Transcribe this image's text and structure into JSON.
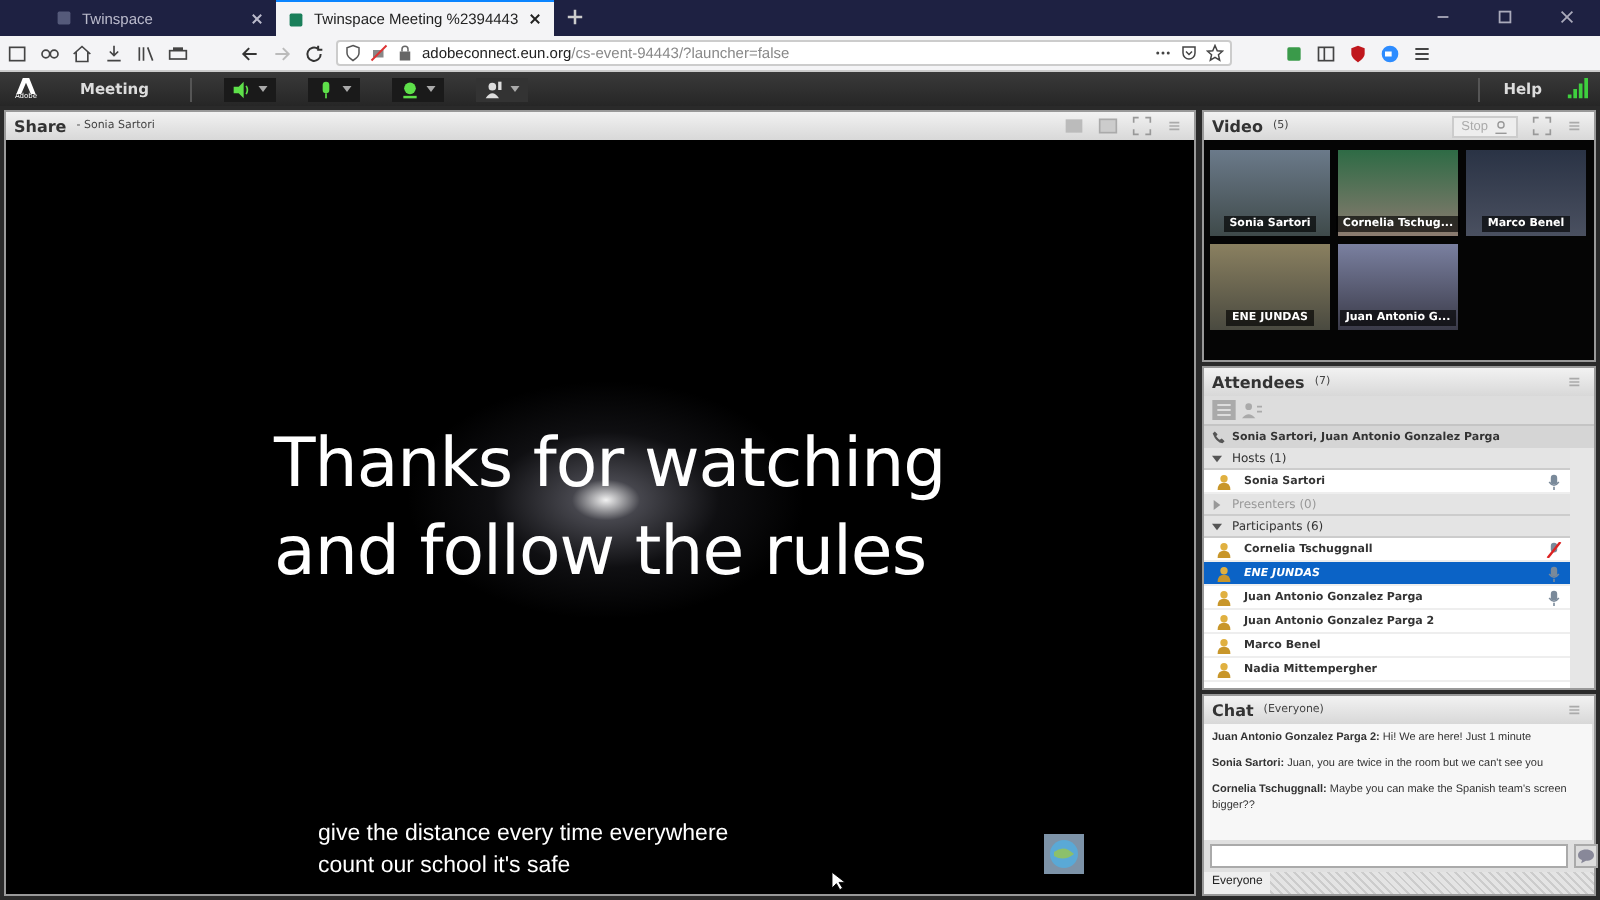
{
  "browser": {
    "tabs": [
      {
        "title": "Twinspace",
        "selected": false
      },
      {
        "title": "Twinspace Meeting %2394443",
        "selected": true
      }
    ],
    "url_host": "adobeconnect.eun.org",
    "url_path": "/cs-event-94443/?launcher=false"
  },
  "app_bar": {
    "logo": "Adobe",
    "menu": "Meeting",
    "controls": [
      {
        "kind": "speaker",
        "on": true
      },
      {
        "kind": "mic",
        "on": true
      },
      {
        "kind": "camera",
        "on": true
      },
      {
        "kind": "hand",
        "on": false
      }
    ],
    "help": "Help"
  },
  "share": {
    "title": "Share",
    "presenter": "- Sonia Sartori",
    "slide_lines": [
      "Thanks for watching",
      "and follow the rules"
    ],
    "captions": [
      "give the distance every time everywhere",
      "count our school it's safe"
    ]
  },
  "video": {
    "title": "Video",
    "count": "(5)",
    "stop": "Stop",
    "tiles": [
      {
        "name": "Sonia Sartori"
      },
      {
        "name": "Cornelia Tschug..."
      },
      {
        "name": "Marco Benel"
      },
      {
        "name": "ENE JUNDAS"
      },
      {
        "name": "Juan Antonio G..."
      }
    ]
  },
  "attendees": {
    "title": "Attendees",
    "count": "(7)",
    "speaking": "Sonia Sartori, Juan Antonio Gonzalez Parga",
    "groups": [
      {
        "label": "Hosts (1)",
        "expanded": true,
        "children": [
          {
            "name": "Sonia Sartori",
            "selected": false,
            "kind": "mic"
          }
        ]
      },
      {
        "label": "Presenters (0)",
        "expanded": false
      },
      {
        "label": "Participants (6)",
        "expanded": true,
        "children": [
          {
            "name": "Cornelia Tschuggnall",
            "selected": false,
            "kind": "muted"
          },
          {
            "name": "ENE JUNDAS",
            "selected": true,
            "kind": "mic"
          },
          {
            "name": "Juan Antonio Gonzalez Parga",
            "selected": false,
            "kind": "mic"
          },
          {
            "name": "Juan Antonio Gonzalez Parga 2",
            "selected": false,
            "kind": "none"
          },
          {
            "name": "Marco Benel",
            "selected": false,
            "kind": "none"
          },
          {
            "name": "Nadia Mittempergher",
            "selected": false,
            "kind": "none"
          }
        ]
      }
    ]
  },
  "chat": {
    "title": "Chat",
    "scope": "(Everyone)",
    "messages": [
      {
        "sender": "Juan Antonio Gonzalez Parga 2:",
        "text": "Hi! We are here! Just 1 minute"
      },
      {
        "sender": "Sonia Sartori:",
        "text": "Juan, you are twice in the room but we can't see you"
      },
      {
        "sender": "Cornelia Tschuggnall:",
        "text": "Maybe you can make the Spanish team's screen bigger??"
      }
    ],
    "tab": "Everyone"
  }
}
